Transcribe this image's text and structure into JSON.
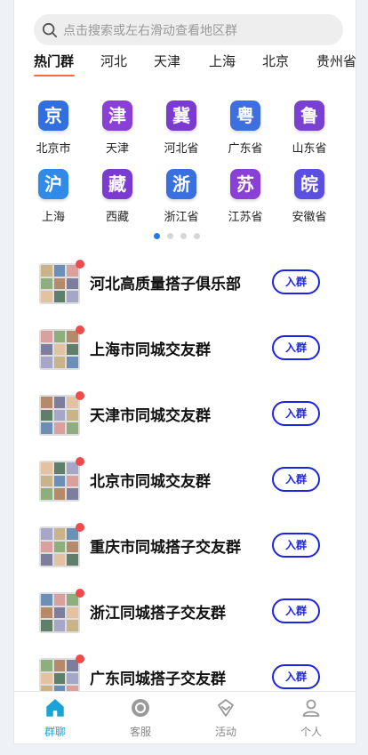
{
  "search": {
    "placeholder": "点击搜索或左右滑动查看地区群"
  },
  "tabs": [
    "热门群",
    "河北",
    "天津",
    "上海",
    "北京",
    "贵州省"
  ],
  "provinces": [
    {
      "char": "京",
      "name": "北京市",
      "color": "#2f6fe0"
    },
    {
      "char": "津",
      "name": "天津",
      "color": "#8a3fd6"
    },
    {
      "char": "冀",
      "name": "河北省",
      "color": "#7b3bd0"
    },
    {
      "char": "粤",
      "name": "广东省",
      "color": "#3d6fe0"
    },
    {
      "char": "鲁",
      "name": "山东省",
      "color": "#7a3fd3"
    },
    {
      "char": "沪",
      "name": "上海",
      "color": "#2f8ae8"
    },
    {
      "char": "藏",
      "name": "西藏",
      "color": "#7b3bd0"
    },
    {
      "char": "浙",
      "name": "浙江省",
      "color": "#3a6fe0"
    },
    {
      "char": "苏",
      "name": "江苏省",
      "color": "#8a3fd6"
    },
    {
      "char": "皖",
      "name": "安徽省",
      "color": "#5a4fe0"
    }
  ],
  "groups": [
    {
      "name": "河北高质量搭子俱乐部",
      "join": "入群"
    },
    {
      "name": "上海市同城交友群",
      "join": "入群"
    },
    {
      "name": "天津市同城交友群",
      "join": "入群"
    },
    {
      "name": "北京市同城交友群",
      "join": "入群"
    },
    {
      "name": "重庆市同城搭子交友群",
      "join": "入群"
    },
    {
      "name": "浙江同城搭子交友群",
      "join": "入群"
    },
    {
      "name": "广东同城搭子交友群",
      "join": "入群"
    }
  ],
  "nav": [
    {
      "label": "群聊",
      "icon": "home-icon",
      "active": true
    },
    {
      "label": "客服",
      "icon": "service-icon",
      "active": false
    },
    {
      "label": "活动",
      "icon": "activity-icon",
      "active": false
    },
    {
      "label": "个人",
      "icon": "user-icon",
      "active": false
    }
  ],
  "colors": {
    "accent": "#1aa3d6",
    "join_button": "#1d24e0",
    "tab_underline": "#ff6a3d",
    "badge": "#f04a4a"
  }
}
